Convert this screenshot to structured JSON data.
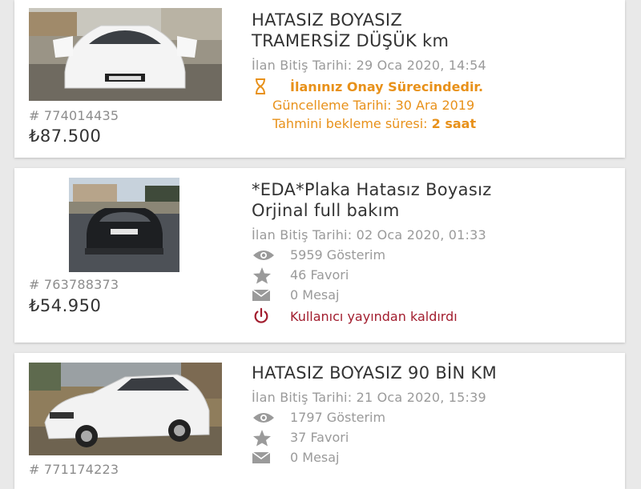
{
  "listings": [
    {
      "title_line1": "HATASIZ BOYASIZ",
      "title_line2": "TRAMERSİZ DÜŞÜK km",
      "end_date": "İlan Bitiş Tarihi: 29 Oca 2020, 14:54",
      "status": "İlanınız Onay Sürecindedir.",
      "updated": "Güncelleme Tarihi: 30 Ara 2019",
      "wait_label": "Tahmini bekleme süresi:",
      "wait_value": "2 saat",
      "id": "# 774014435",
      "price": "₺87.500"
    },
    {
      "title_line1": "*EDA*Plaka Hatasız Boyasız",
      "title_line2": "Orjinal full bakım",
      "end_date": "İlan Bitiş Tarihi: 02 Oca 2020, 01:33",
      "views": "5959 Gösterim",
      "favorites": "46 Favori",
      "messages": "0 Mesaj",
      "removed": "Kullanıcı yayından kaldırdı",
      "id": "# 763788373",
      "price": "₺54.950"
    },
    {
      "title_line1": "HATASIZ BOYASIZ 90 BİN KM",
      "end_date": "İlan Bitiş Tarihi: 21 Oca 2020, 15:39",
      "views": "1797 Gösterim",
      "favorites": "37 Favori",
      "messages": "0 Mesaj",
      "id": "# 771174223"
    }
  ],
  "colors": {
    "pending": "#e8911a",
    "removed": "#a21d2e",
    "muted": "#9a9a9a"
  },
  "icons": [
    "hourglass-icon",
    "eye-icon",
    "star-icon",
    "mail-icon",
    "power-icon"
  ]
}
